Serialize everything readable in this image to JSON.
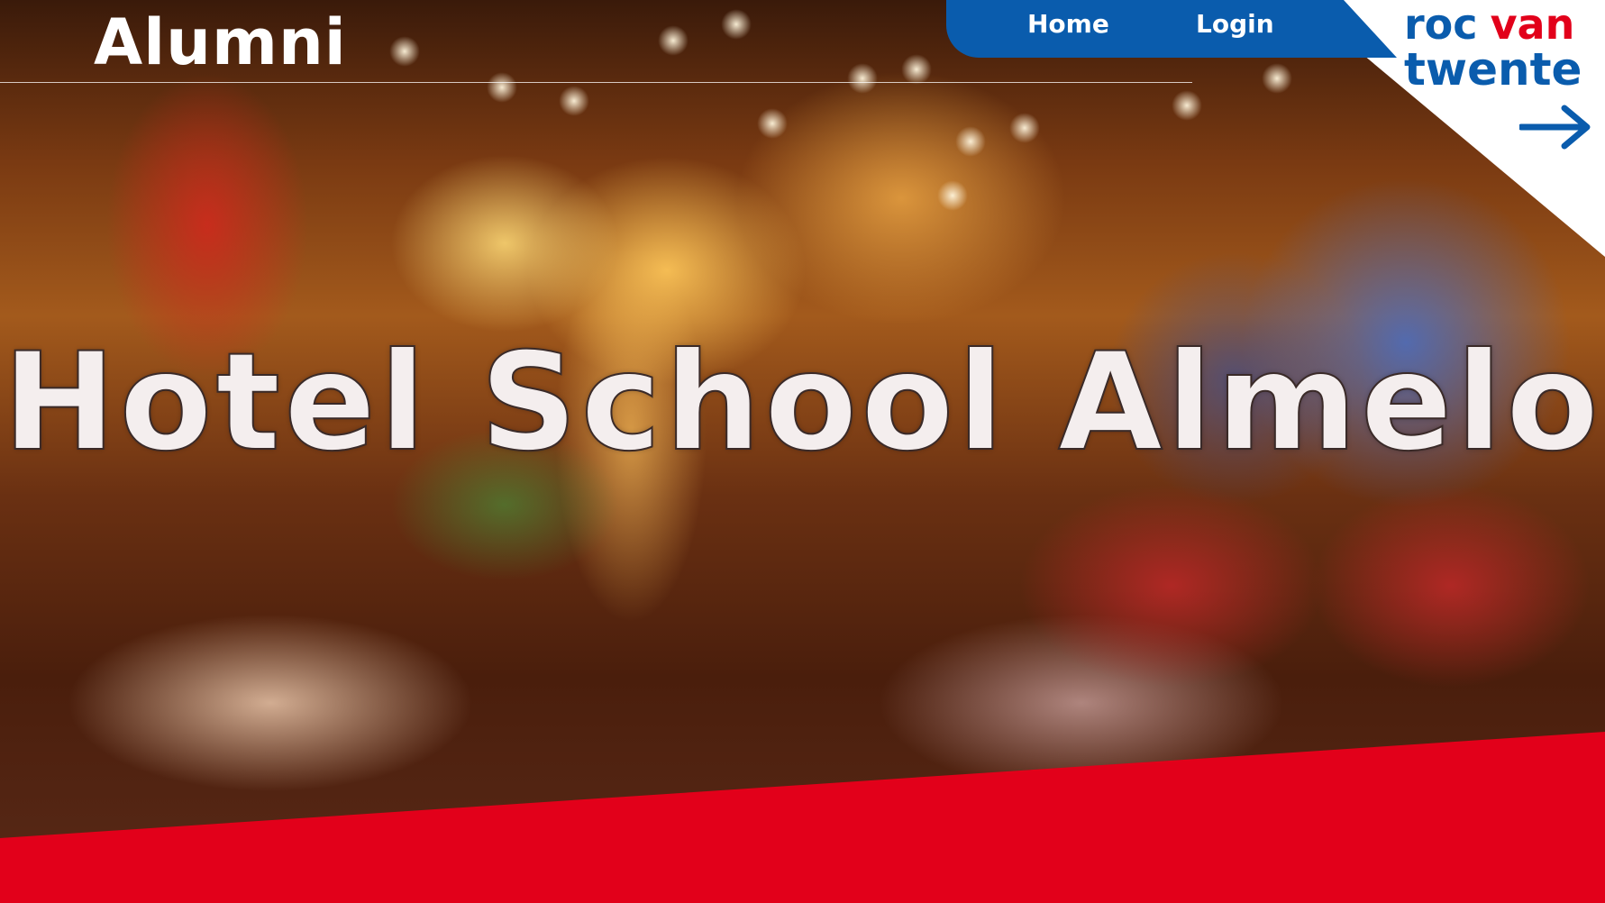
{
  "header": {
    "brand_title": "Alumni",
    "nav": {
      "home_label": "Home",
      "login_label": "Login"
    },
    "logo": {
      "word_roc": "roc",
      "word_van": "van",
      "word_twente": "twente",
      "arrow_icon": "arrow-right-icon"
    }
  },
  "hero": {
    "title": "Hotel School Almelo"
  },
  "colors": {
    "brand_blue": "#0a5cad",
    "brand_red": "#e2001a",
    "white": "#ffffff"
  }
}
